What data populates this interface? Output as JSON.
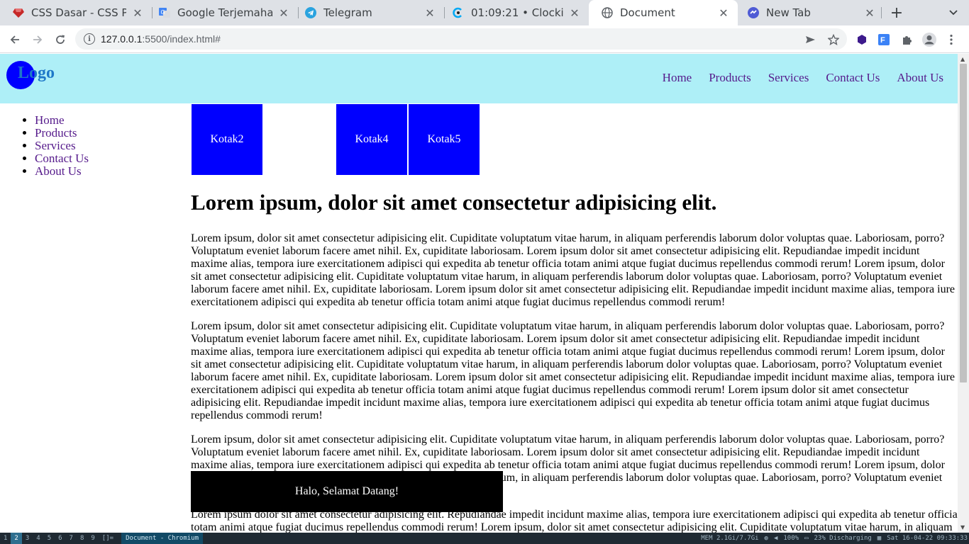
{
  "browser": {
    "tabs": [
      {
        "title": "CSS Dasar - CSS Posi",
        "icon": "ruby-gem-icon",
        "color": "#c62828"
      },
      {
        "title": "Google Terjemahan",
        "icon": "google-translate-icon",
        "color": "#4285f4"
      },
      {
        "title": "Telegram",
        "icon": "telegram-icon",
        "color": "#2aa3df"
      },
      {
        "title": "01:09:21 • Clockify",
        "icon": "clockify-icon",
        "color": "#03a9f4"
      },
      {
        "title": "Document",
        "icon": "globe-icon",
        "color": "#5f6368",
        "active": true
      },
      {
        "title": "New Tab",
        "icon": "new-tab-icon",
        "color": "#4f5bd5"
      }
    ],
    "new_tab": "+",
    "url_host": "127.0.0.1",
    "url_rest": ":5500/index.html#"
  },
  "page": {
    "logo": "Logo",
    "nav": [
      "Home",
      "Products",
      "Services",
      "Contact Us",
      "About Us"
    ],
    "sidebar": [
      "Home",
      "Products",
      "Services",
      "Contact Us",
      "About Us"
    ],
    "boxes": [
      "Kotak2",
      "Kotak4",
      "Kotak5"
    ],
    "heading": "Lorem ipsum, dolor sit amet consectetur adipisicing elit.",
    "paragraphs": [
      "Lorem ipsum, dolor sit amet consectetur adipisicing elit. Cupiditate voluptatum vitae harum, in aliquam perferendis laborum dolor voluptas quae. Laboriosam, porro? Voluptatum eveniet laborum facere amet nihil. Ex, cupiditate laboriosam. Lorem ipsum dolor sit amet consectetur adipisicing elit. Repudiandae impedit incidunt maxime alias, tempora iure exercitationem adipisci qui expedita ab tenetur officia totam animi atque fugiat ducimus repellendus commodi rerum! Lorem ipsum, dolor sit amet consectetur adipisicing elit. Cupiditate voluptatum vitae harum, in aliquam perferendis laborum dolor voluptas quae. Laboriosam, porro? Voluptatum eveniet laborum facere amet nihil. Ex, cupiditate laboriosam. Lorem ipsum dolor sit amet consectetur adipisicing elit. Repudiandae impedit incidunt maxime alias, tempora iure exercitationem adipisci qui expedita ab tenetur officia totam animi atque fugiat ducimus repellendus commodi rerum!",
      "Lorem ipsum, dolor sit amet consectetur adipisicing elit. Cupiditate voluptatum vitae harum, in aliquam perferendis laborum dolor voluptas quae. Laboriosam, porro? Voluptatum eveniet laborum facere amet nihil. Ex, cupiditate laboriosam. Lorem ipsum dolor sit amet consectetur adipisicing elit. Repudiandae impedit incidunt maxime alias, tempora iure exercitationem adipisci qui expedita ab tenetur officia totam animi atque fugiat ducimus repellendus commodi rerum! Lorem ipsum, dolor sit amet consectetur adipisicing elit. Cupiditate voluptatum vitae harum, in aliquam perferendis laborum dolor voluptas quae. Laboriosam, porro? Voluptatum eveniet laborum facere amet nihil. Ex, cupiditate laboriosam. Lorem ipsum dolor sit amet consectetur adipisicing elit. Repudiandae impedit incidunt maxime alias, tempora iure exercitationem adipisci qui expedita ab tenetur officia totam animi atque fugiat ducimus repellendus commodi rerum! Lorem ipsum dolor sit amet consectetur adipisicing elit. Repudiandae impedit incidunt maxime alias, tempora iure exercitationem adipisci qui expedita ab tenetur officia totam animi atque fugiat ducimus repellendus commodi rerum!",
      "Lorem ipsum, dolor sit amet consectetur adipisicing elit. Cupiditate voluptatum vitae harum, in aliquam perferendis laborum dolor voluptas quae. Laboriosam, porro? Voluptatum eveniet laborum facere amet nihil. Ex, cupiditate laboriosam. Lorem ipsum dolor sit amet consectetur adipisicing elit. Repudiandae impedit incidunt maxime alias, tempora iure exercitationem adipisci qui expedita ab tenetur officia totam animi atque fugiat ducimus repellendus commodi rerum! Lorem ipsum, dolor sit amet consectetur adipisicing elit. Cupiditate voluptatum vitae harum, in aliquam perferendis laborum dolor voluptas quae. Laboriosam, porro? Voluptatum eveniet laborum facere amet nihil. Ex, cupiditate laboriosam.",
      "Lorem ipsum dolor sit amet consectetur adipisicing elit. Repudiandae impedit incidunt maxime alias, tempora iure exercitationem adipisci qui expedita ab tenetur officia totam animi atque fugiat ducimus repellendus commodi rerum! Lorem ipsum, dolor sit amet consectetur adipisicing elit. Cupiditate voluptatum vitae harum, in aliquam perferendis laborum dolor voluptas quae."
    ],
    "banner": "Halo, Selamat Datang!"
  },
  "statusbar": {
    "workspaces": [
      "1",
      "2",
      "3",
      "4",
      "5",
      "6",
      "7",
      "8",
      "9"
    ],
    "layout": "[]=",
    "window_title": "Document - Chromium",
    "mem": "MEM 2.1Gi/7.7Gi",
    "volume": "100%",
    "battery": "23% Discharging",
    "datetime": "Sat 16-04-22 09:33:33"
  }
}
